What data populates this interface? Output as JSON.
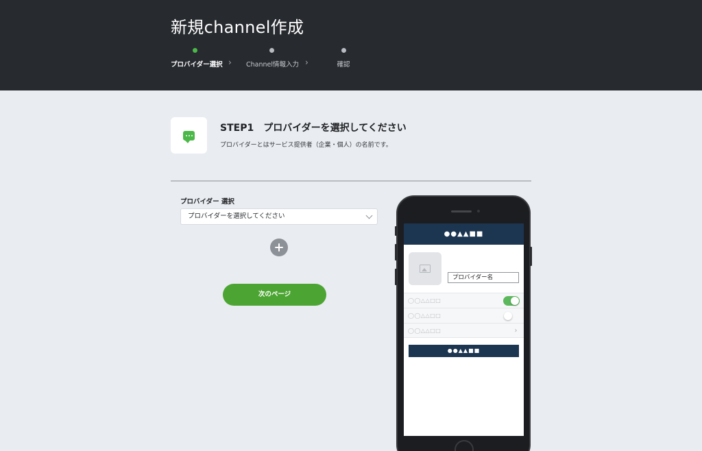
{
  "header": {
    "title": "新規channel作成",
    "steps": [
      {
        "label": "プロバイダー選択",
        "active": true
      },
      {
        "label": "Channel情報入力",
        "active": false
      },
      {
        "label": "確認",
        "active": false
      }
    ]
  },
  "intro": {
    "icon": "chat-bubble-icon",
    "heading": "STEP1　プロバイダーを選択してください",
    "description": "プロバイダーとはサービス提供者（企業・個人）の名前です。"
  },
  "form": {
    "provider_label": "プロバイダー 選択",
    "provider_select_value": "プロバイダーを選択してください",
    "add_icon": "plus-circle-icon",
    "next_button_label": "次のページ"
  },
  "phone_preview": {
    "nav_title": "●●▲▲■■",
    "name_field": "プロバイダー名",
    "rows": [
      {
        "label": "◯◯△△□□",
        "control": "toggle-on"
      },
      {
        "label": "◯◯△△□□",
        "control": "toggle-off"
      },
      {
        "label": "◯◯△△□□",
        "control": "chevron"
      }
    ],
    "button_label": "●●▲▲■■"
  },
  "colors": {
    "header_bg": "#272a2f",
    "page_bg": "#e9ecf0",
    "accent_green": "#4ca533",
    "phone_navy": "#1c3550"
  }
}
